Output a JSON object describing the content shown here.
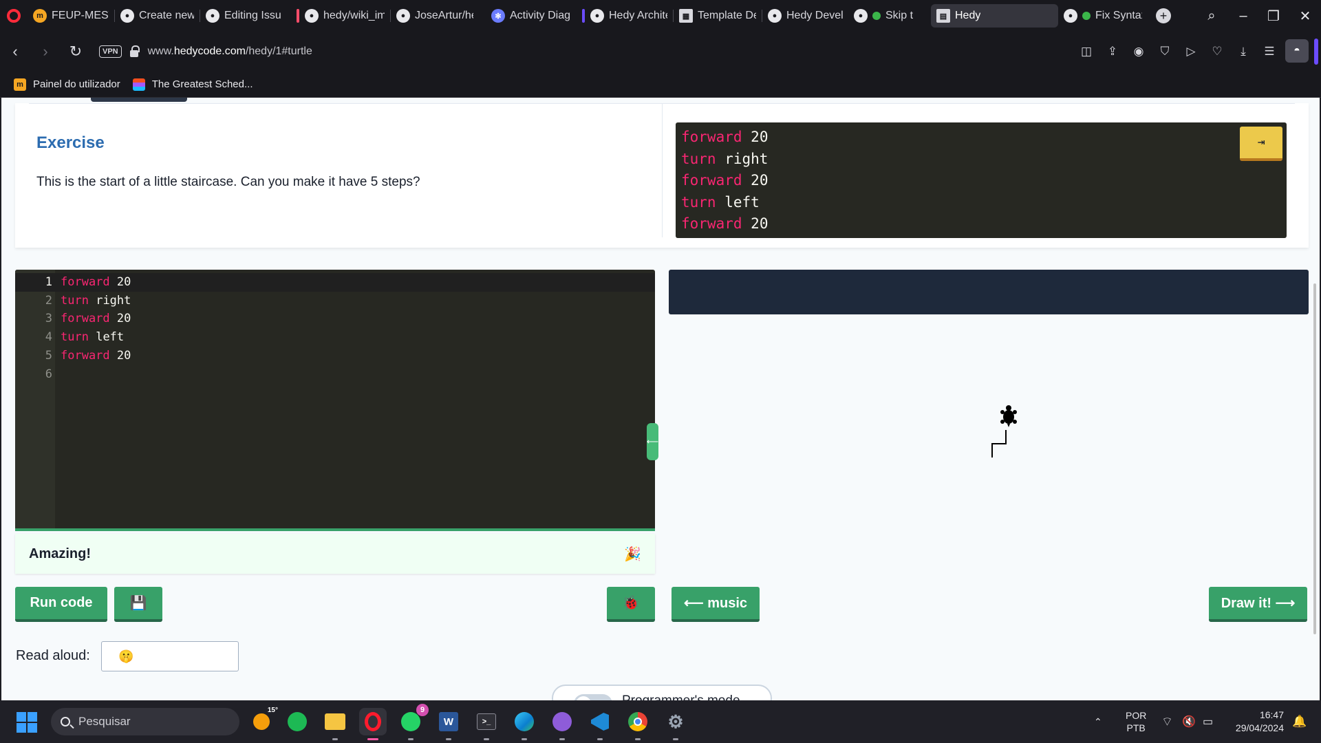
{
  "browser": {
    "tabs": [
      {
        "label": "FEUP-MESW(",
        "icon": "moodle-icon"
      },
      {
        "label": "Create new p",
        "icon": "github-icon"
      },
      {
        "label": "Editing Issue",
        "icon": "github-icon"
      },
      {
        "label": "hedy/wiki_im",
        "icon": "github-icon"
      },
      {
        "label": "JoseArtur/hec",
        "icon": "github-icon"
      },
      {
        "label": "Activity Diagr",
        "icon": "diagram-icon"
      },
      {
        "label": "Hedy Archite",
        "icon": "github-icon"
      },
      {
        "label": "Template De:",
        "icon": "template-icon"
      },
      {
        "label": "Hedy Develo",
        "icon": "github-icon"
      },
      {
        "label": "Skip t",
        "icon": "github-icon"
      },
      {
        "label": "Hedy",
        "icon": "hedy-icon"
      },
      {
        "label": "Fix Syntax",
        "icon": "github-icon"
      }
    ],
    "url_prefix": "www.",
    "url_domain": "hedycode.com",
    "url_path": "/hedy/1#turtle",
    "vpn_label": "VPN",
    "bookmarks": [
      {
        "label": "Painel do utilizador",
        "icon": "moodle-icon"
      },
      {
        "label": "The Greatest Sched...",
        "icon": "figma-icon"
      }
    ]
  },
  "exercise": {
    "title": "Exercise",
    "text": "This is the start of a little staircase. Can you make it have 5 steps?",
    "example_code": [
      {
        "kw": "forward",
        "arg": "20"
      },
      {
        "kw": "turn",
        "arg": "right"
      },
      {
        "kw": "forward",
        "arg": "20"
      },
      {
        "kw": "turn",
        "arg": "left"
      },
      {
        "kw": "forward",
        "arg": "20"
      }
    ],
    "copy_button_icon": "⇥"
  },
  "editor": {
    "lines": [
      {
        "num": "1",
        "kw": "forward",
        "arg": "20"
      },
      {
        "num": "2",
        "kw": "turn",
        "arg": "right"
      },
      {
        "num": "3",
        "kw": "forward",
        "arg": "20"
      },
      {
        "num": "4",
        "kw": "turn",
        "arg": "left"
      },
      {
        "num": "5",
        "kw": "forward",
        "arg": "20"
      },
      {
        "num": "6",
        "kw": "",
        "arg": ""
      }
    ],
    "resize_icon": "⟵"
  },
  "feedback": {
    "message": "Amazing!",
    "icon": "🎉"
  },
  "buttons": {
    "run_code": "Run code",
    "save_icon": "💾",
    "debug_icon": "🐞",
    "music": "⟵ music",
    "draw": "Draw it! ⟶"
  },
  "read_aloud": {
    "label": "Read aloud:",
    "selected_icon": "🤫"
  },
  "programmers_mode": {
    "label": "Programmer's mode"
  },
  "taskbar": {
    "search_placeholder": "Pesquisar",
    "weather": "15°",
    "whatsapp_badge": "9",
    "lang_top": "POR",
    "lang_bottom": "PTB",
    "time": "16:47",
    "date": "29/04/2024"
  },
  "colors": {
    "keyword": "#f92672",
    "editor_bg": "#272822",
    "accent_green": "#38a169",
    "exercise_title": "#2c6cb0"
  }
}
